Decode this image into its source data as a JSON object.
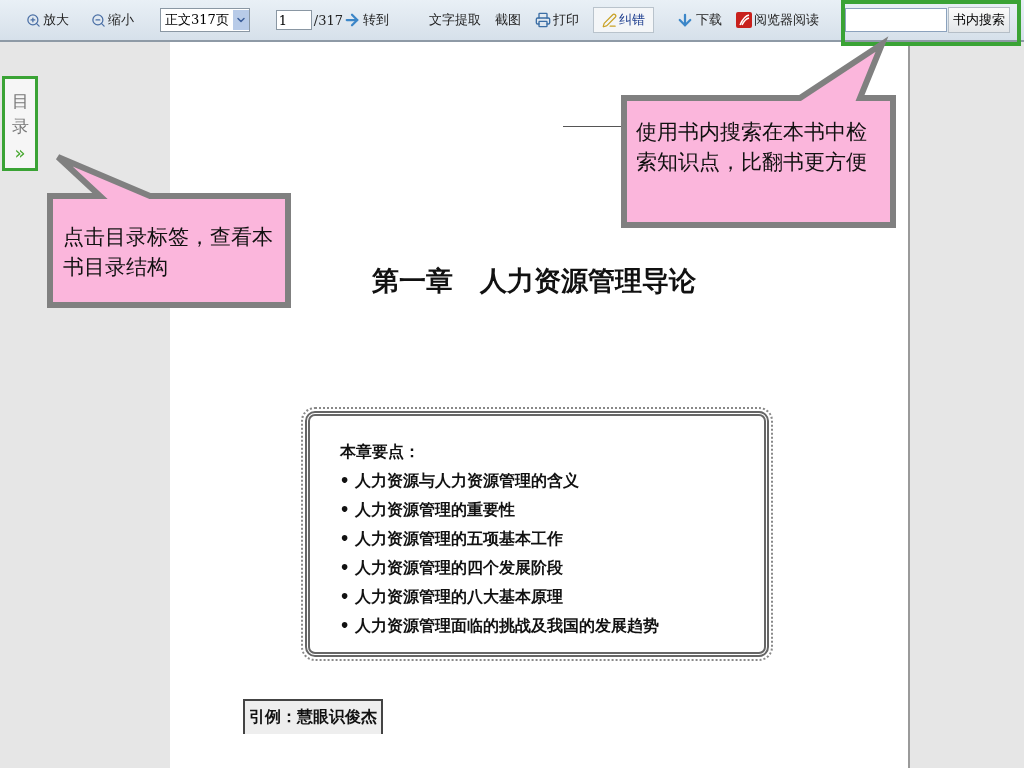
{
  "toolbar": {
    "items": [
      {
        "kind": "zoomin",
        "label": "放大"
      },
      {
        "kind": "zoomout",
        "label": "缩小"
      },
      {
        "kind": "select",
        "value": "正文317页"
      },
      {
        "kind": "pager",
        "value": "1",
        "total": "/317"
      },
      {
        "kind": "goto",
        "label": "转到"
      },
      {
        "kind": "text",
        "label": "文字提取"
      },
      {
        "kind": "text",
        "label": "截图"
      },
      {
        "kind": "print",
        "label": "打印"
      },
      {
        "kind": "report",
        "label": "纠错"
      },
      {
        "kind": "download",
        "label": "下载"
      },
      {
        "kind": "reader",
        "label": "阅览器阅读"
      }
    ],
    "search": {
      "button": "书内搜索"
    }
  },
  "sidebar_tab": {
    "label": "目录",
    "arrow": "»"
  },
  "page": {
    "title": "第一章　人力资源管理导论",
    "summary": {
      "heading": "本章要点：",
      "items": [
        "• 人力资源与人力资源管理的含义",
        "• 人力资源管理的重要性",
        "• 人力资源管理的五项基本工作",
        "• 人力资源管理的四个发展阶段",
        "• 人力资源管理的八大基本原理",
        "• 人力资源管理面临的挑战及我国的发展趋势"
      ]
    },
    "example_label": "引例：慧眼识俊杰"
  },
  "callouts": [
    {
      "text": "点击目录标签，查看本书目录结构"
    },
    {
      "text": "使用书内搜索在本书中检索知识点，比翻书更方便"
    }
  ]
}
